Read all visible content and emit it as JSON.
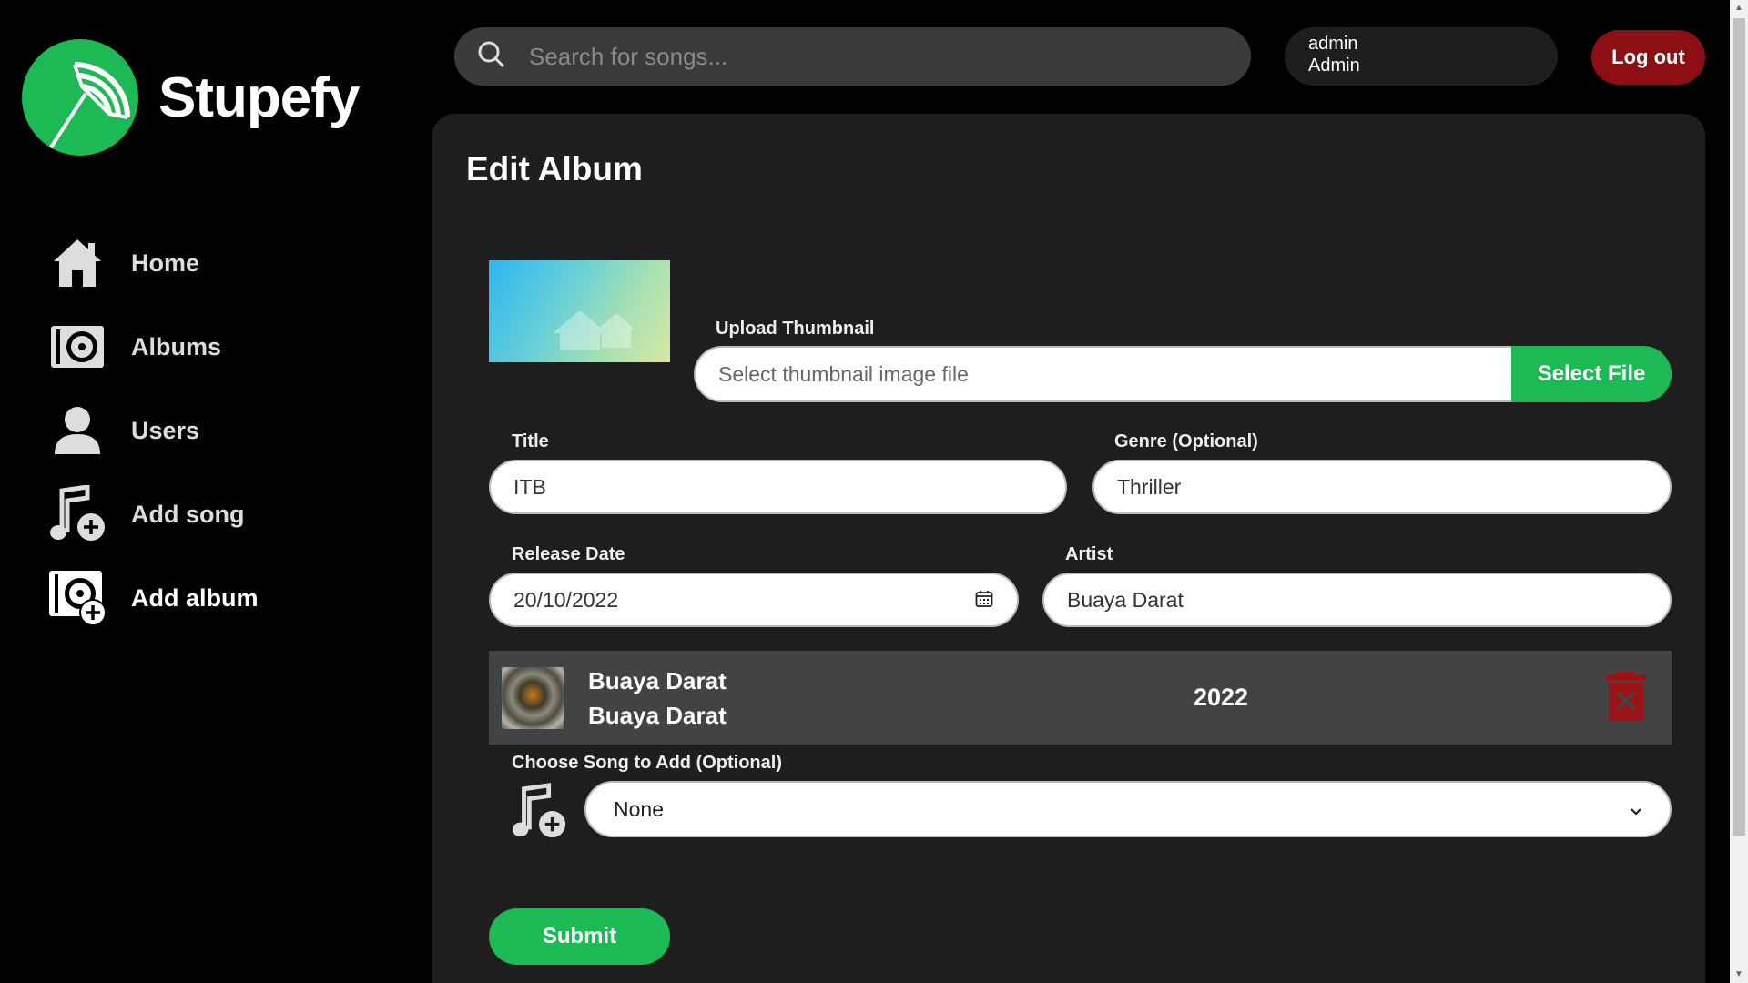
{
  "app": {
    "name": "Stupefy"
  },
  "sidebar": {
    "items": [
      {
        "label": "Home",
        "icon": "home-icon"
      },
      {
        "label": "Albums",
        "icon": "album-icon"
      },
      {
        "label": "Users",
        "icon": "user-icon"
      },
      {
        "label": "Add song",
        "icon": "add-song-icon"
      },
      {
        "label": "Add album",
        "icon": "add-album-icon",
        "active": true
      }
    ]
  },
  "header": {
    "search_placeholder": "Search for songs...",
    "user": {
      "username": "admin",
      "name": "Admin"
    },
    "logout_label": "Log out"
  },
  "page": {
    "title": "Edit Album",
    "upload": {
      "label": "Upload Thumbnail",
      "placeholder": "Select thumbnail image file",
      "button": "Select File"
    },
    "title_field": {
      "label": "Title",
      "value": "ITB"
    },
    "genre_field": {
      "label": "Genre (Optional)",
      "value": "Thriller"
    },
    "date_field": {
      "label": "Release Date",
      "value": "20/10/2022"
    },
    "artist_field": {
      "label": "Artist",
      "value": "Buaya Darat"
    },
    "song": {
      "title": "Buaya Darat",
      "artist": "Buaya Darat",
      "year": "2022"
    },
    "choose_song": {
      "label": "Choose Song to Add (Optional)",
      "selected": "None"
    },
    "submit_label": "Submit"
  },
  "colors": {
    "accent": "#1db954",
    "danger": "#8b0f13",
    "panel": "#1e1e1e",
    "row": "#434343"
  }
}
